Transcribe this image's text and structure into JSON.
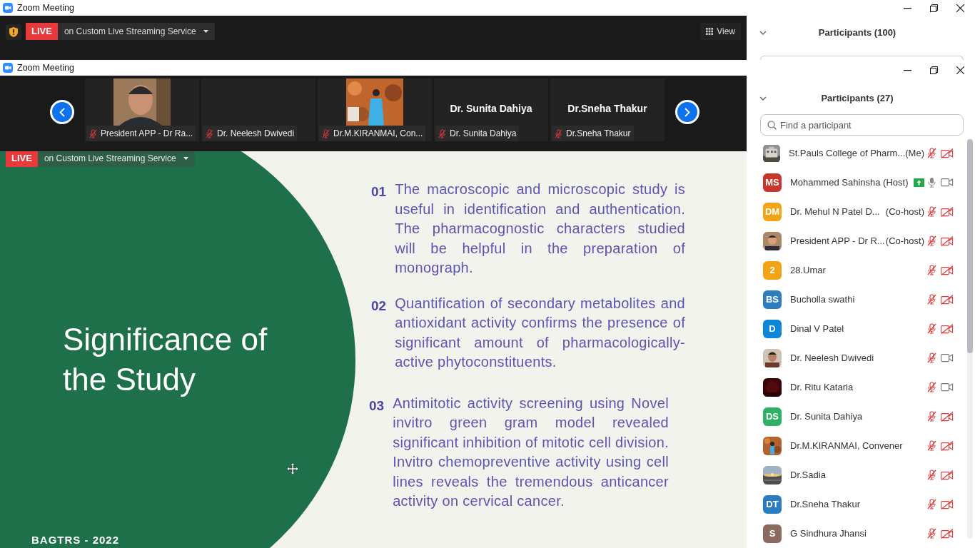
{
  "back_window": {
    "title": "Zoom Meeting",
    "live_badge": "LIVE",
    "stream_menu": "on Custom Live Streaming Service",
    "view_button": "View",
    "participants_header": "Participants (100)"
  },
  "window": {
    "title": "Zoom Meeting"
  },
  "filmstrip": [
    {
      "kind": "picture",
      "label": "President APP - Dr Ra...",
      "muted": true
    },
    {
      "kind": "blank",
      "label": "Dr. Neelesh Dwivedi",
      "muted": true
    },
    {
      "kind": "picture",
      "label": "Dr.M.KIRANMAI, Con...",
      "muted": true
    },
    {
      "kind": "name",
      "caption": "Dr. Sunita Dahiya",
      "label": "Dr. Sunita Dahiya",
      "muted": true
    },
    {
      "kind": "name",
      "caption": "Dr.Sneha Thakur",
      "label": "Dr.Sneha Thakur",
      "muted": true
    }
  ],
  "slide": {
    "live_badge": "LIVE",
    "stream_menu": "on Custom Live Streaming Service",
    "title": "Significance of the Study",
    "points": [
      {
        "number": "01",
        "text": "The macroscopic and microscopic study is useful in identification and authentication. The pharmacognostic characters studied will be helpful in the preparation of monograph."
      },
      {
        "number": "02",
        "text": "Quantification of secondary metabolites and antioxidant activity confirms the presence of significant amount of pharmacologically-active phytoconstituents."
      },
      {
        "number": "03",
        "text": "Antimitotic activity screening using Novel invitro green gram model revealed significant inhibition of mitotic cell division. Invitro chemopreventive activity using cell lines reveals the tremendous anticancer activity on cervical cancer."
      }
    ],
    "footer": "BAGTRS - 2022"
  },
  "participants_panel": {
    "header": "Participants (27)",
    "search": {
      "placeholder": "Find a participant"
    },
    "participants": [
      {
        "kind": "picture",
        "name": "St.Pauls College of Pharm...",
        "role": "(Me)",
        "sharing": false,
        "muted": true,
        "video_on": false
      },
      {
        "kind": "initials",
        "initials": "MS",
        "color": "#c8372b",
        "name": "Mohammed Sahinsha (Host)",
        "sharing": true,
        "muted": false,
        "video_on": true
      },
      {
        "kind": "initials",
        "initials": "DM",
        "color": "#f2a316",
        "name": "Dr. Mehul N Patel D...",
        "role": "(Co-host)",
        "sharing": false,
        "muted": true,
        "video_on": false
      },
      {
        "kind": "picture",
        "name": "President APP - Dr R...",
        "role": "(Co-host)",
        "sharing": false,
        "muted": true,
        "video_on": false
      },
      {
        "kind": "initials",
        "initials": "2",
        "color": "#f2a316",
        "name": "28.Umar",
        "sharing": false,
        "muted": true,
        "video_on": false
      },
      {
        "kind": "initials",
        "initials": "BS",
        "color": "#2e7dbd",
        "name": "Bucholla swathi",
        "sharing": false,
        "muted": true,
        "video_on": false
      },
      {
        "kind": "initials",
        "initials": "D",
        "color": "#0b86d8",
        "name": "Dinal V Patel",
        "sharing": false,
        "muted": true,
        "video_on": false
      },
      {
        "kind": "picture",
        "name": "Dr. Neelesh Dwivedi",
        "sharing": false,
        "muted": true,
        "video_on": true
      },
      {
        "kind": "picture",
        "name": "Dr. Ritu Kataria",
        "sharing": false,
        "muted": true,
        "video_on": true
      },
      {
        "kind": "initials",
        "initials": "DS",
        "color": "#2db165",
        "name": "Dr. Sunita Dahiya",
        "sharing": false,
        "muted": true,
        "video_on": false
      },
      {
        "kind": "picture",
        "name": "Dr.M.KIRANMAI, Convener",
        "sharing": false,
        "muted": true,
        "video_on": false
      },
      {
        "kind": "picture",
        "name": "Dr.Sadia",
        "sharing": false,
        "muted": true,
        "video_on": false
      },
      {
        "kind": "initials",
        "initials": "DT",
        "color": "#2b7dbf",
        "name": "Dr.Sneha Thakur",
        "sharing": false,
        "muted": true,
        "video_on": false
      },
      {
        "kind": "initials",
        "initials": "S",
        "color": "#8c6b5f",
        "name": "G Sindhura Jhansi",
        "sharing": false,
        "muted": true,
        "video_on": false
      }
    ]
  }
}
